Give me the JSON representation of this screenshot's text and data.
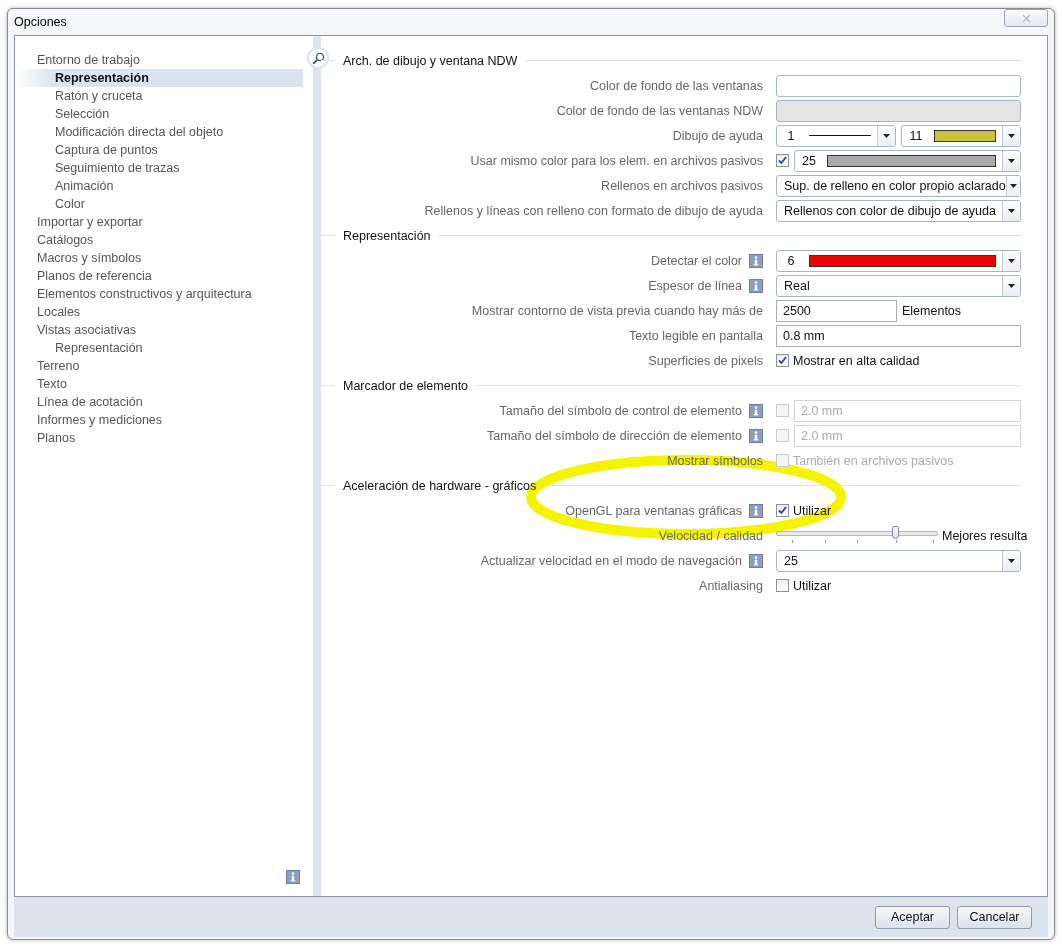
{
  "window": {
    "title": "Opciones"
  },
  "sidebar": {
    "items": [
      {
        "label": "Entorno de trabajo",
        "selected": false,
        "children": [
          {
            "label": "Representación",
            "selected": true
          },
          {
            "label": "Ratón y cruceta",
            "selected": false
          },
          {
            "label": "Selección",
            "selected": false
          },
          {
            "label": "Modificación directa del objeto",
            "selected": false
          },
          {
            "label": "Captura de puntos",
            "selected": false
          },
          {
            "label": "Seguimiento de trazas",
            "selected": false
          },
          {
            "label": "Animación",
            "selected": false
          },
          {
            "label": "Color",
            "selected": false
          }
        ]
      },
      {
        "label": "Importar y exportar",
        "selected": false
      },
      {
        "label": "Catálogos",
        "selected": false
      },
      {
        "label": "Macros y símbolos",
        "selected": false
      },
      {
        "label": "Planos de referencia",
        "selected": false
      },
      {
        "label": "Elementos constructivos y arquitectura",
        "selected": false
      },
      {
        "label": "Locales",
        "selected": false
      },
      {
        "label": "Vistas asociativas",
        "selected": false,
        "children": [
          {
            "label": "Representación",
            "selected": false
          }
        ]
      },
      {
        "label": "Terreno",
        "selected": false
      },
      {
        "label": "Texto",
        "selected": false
      },
      {
        "label": "Línea de acotación",
        "selected": false
      },
      {
        "label": "Informes y mediciones",
        "selected": false
      },
      {
        "label": "Planos",
        "selected": false
      }
    ]
  },
  "sections": [
    {
      "title": "Arch. de dibujo y ventana NDW",
      "rows": [
        {
          "label": "Color de fondo de las ventanas",
          "info": false,
          "controls": [
            {
              "kind": "swatch",
              "color": "#ffffff"
            }
          ]
        },
        {
          "label": "Color de fondo de las ventanas NDW",
          "info": false,
          "controls": [
            {
              "kind": "swatch",
              "color": "#e4e4e4"
            }
          ]
        },
        {
          "label": "Dibujo de ayuda",
          "info": false,
          "controls": [
            {
              "kind": "pen",
              "value": "1"
            },
            {
              "kind": "color",
              "value": "11",
              "color": "#c8c43a"
            }
          ]
        },
        {
          "label": "Usar mismo color para los elem. en archivos pasivos",
          "info": false,
          "controls": [
            {
              "kind": "checkbox",
              "checked": true,
              "disabled": false
            },
            {
              "kind": "color",
              "value": "25",
              "color": "#a9a9a9"
            }
          ]
        },
        {
          "label": "Rellenos en archivos pasivos",
          "info": false,
          "controls": [
            {
              "kind": "select",
              "value": "Sup. de relleno en color propio aclarado"
            }
          ]
        },
        {
          "label": "Rellenos y líneas con relleno con formato de dibujo de ayuda",
          "info": false,
          "controls": [
            {
              "kind": "select",
              "value": "Rellenos con color de dibujo de ayuda"
            }
          ]
        }
      ]
    },
    {
      "title": "Representación",
      "rows": [
        {
          "label": "Detectar el color",
          "info": true,
          "controls": [
            {
              "kind": "color",
              "value": "6",
              "color": "#ee0000"
            }
          ]
        },
        {
          "label": "Espesor de línea",
          "info": true,
          "controls": [
            {
              "kind": "select",
              "value": "Real"
            }
          ]
        },
        {
          "label": "Mostrar contorno de vista previa cuando hay más de",
          "info": false,
          "controls": [
            {
              "kind": "field",
              "value": "2500",
              "disabled": false,
              "suffix": "Elementos"
            }
          ]
        },
        {
          "label": "Texto legible en pantalla",
          "info": false,
          "controls": [
            {
              "kind": "field",
              "value": "0.8 mm",
              "disabled": false
            }
          ]
        },
        {
          "label": "Superficies de pixels",
          "info": false,
          "controls": [
            {
              "kind": "checkbox",
              "checked": true,
              "disabled": false,
              "label": "Mostrar en alta calidad"
            }
          ]
        }
      ]
    },
    {
      "title": "Marcador de elemento",
      "rows": [
        {
          "label": "Tamaño del símbolo de control de elemento",
          "info": true,
          "controls": [
            {
              "kind": "checkbox",
              "checked": false,
              "disabled": true
            },
            {
              "kind": "field",
              "value": "2.0 mm",
              "disabled": true
            }
          ]
        },
        {
          "label": "Tamaño del símbolo de dirección de elemento",
          "info": true,
          "controls": [
            {
              "kind": "checkbox",
              "checked": false,
              "disabled": true
            },
            {
              "kind": "field",
              "value": "2.0 mm",
              "disabled": true
            }
          ]
        },
        {
          "label": "Mostrar símbolos",
          "info": false,
          "controls": [
            {
              "kind": "checkbox",
              "checked": false,
              "disabled": true,
              "label": "También en archivos pasivos"
            }
          ]
        }
      ]
    },
    {
      "title": "Aceleración de hardware - gráficos",
      "rows": [
        {
          "label": "OpenGL para ventanas gráficas",
          "info": true,
          "controls": [
            {
              "kind": "checkbox",
              "checked": true,
              "disabled": false,
              "label": "Utilizar"
            }
          ]
        },
        {
          "label": "Velocidad / calidad",
          "info": false,
          "controls": [
            {
              "kind": "slider",
              "level": 0.74,
              "label": "Mejores resulta"
            }
          ]
        },
        {
          "label": "Actualizar velocidad en el modo de navegación",
          "info": true,
          "controls": [
            {
              "kind": "select",
              "value": "25"
            }
          ]
        },
        {
          "label": "Antialiasing",
          "info": false,
          "controls": [
            {
              "kind": "checkbox",
              "checked": false,
              "disabled": false,
              "label": "Utilizar"
            }
          ]
        }
      ]
    }
  ],
  "buttons": [
    "Aceptar",
    "Cancelar"
  ]
}
